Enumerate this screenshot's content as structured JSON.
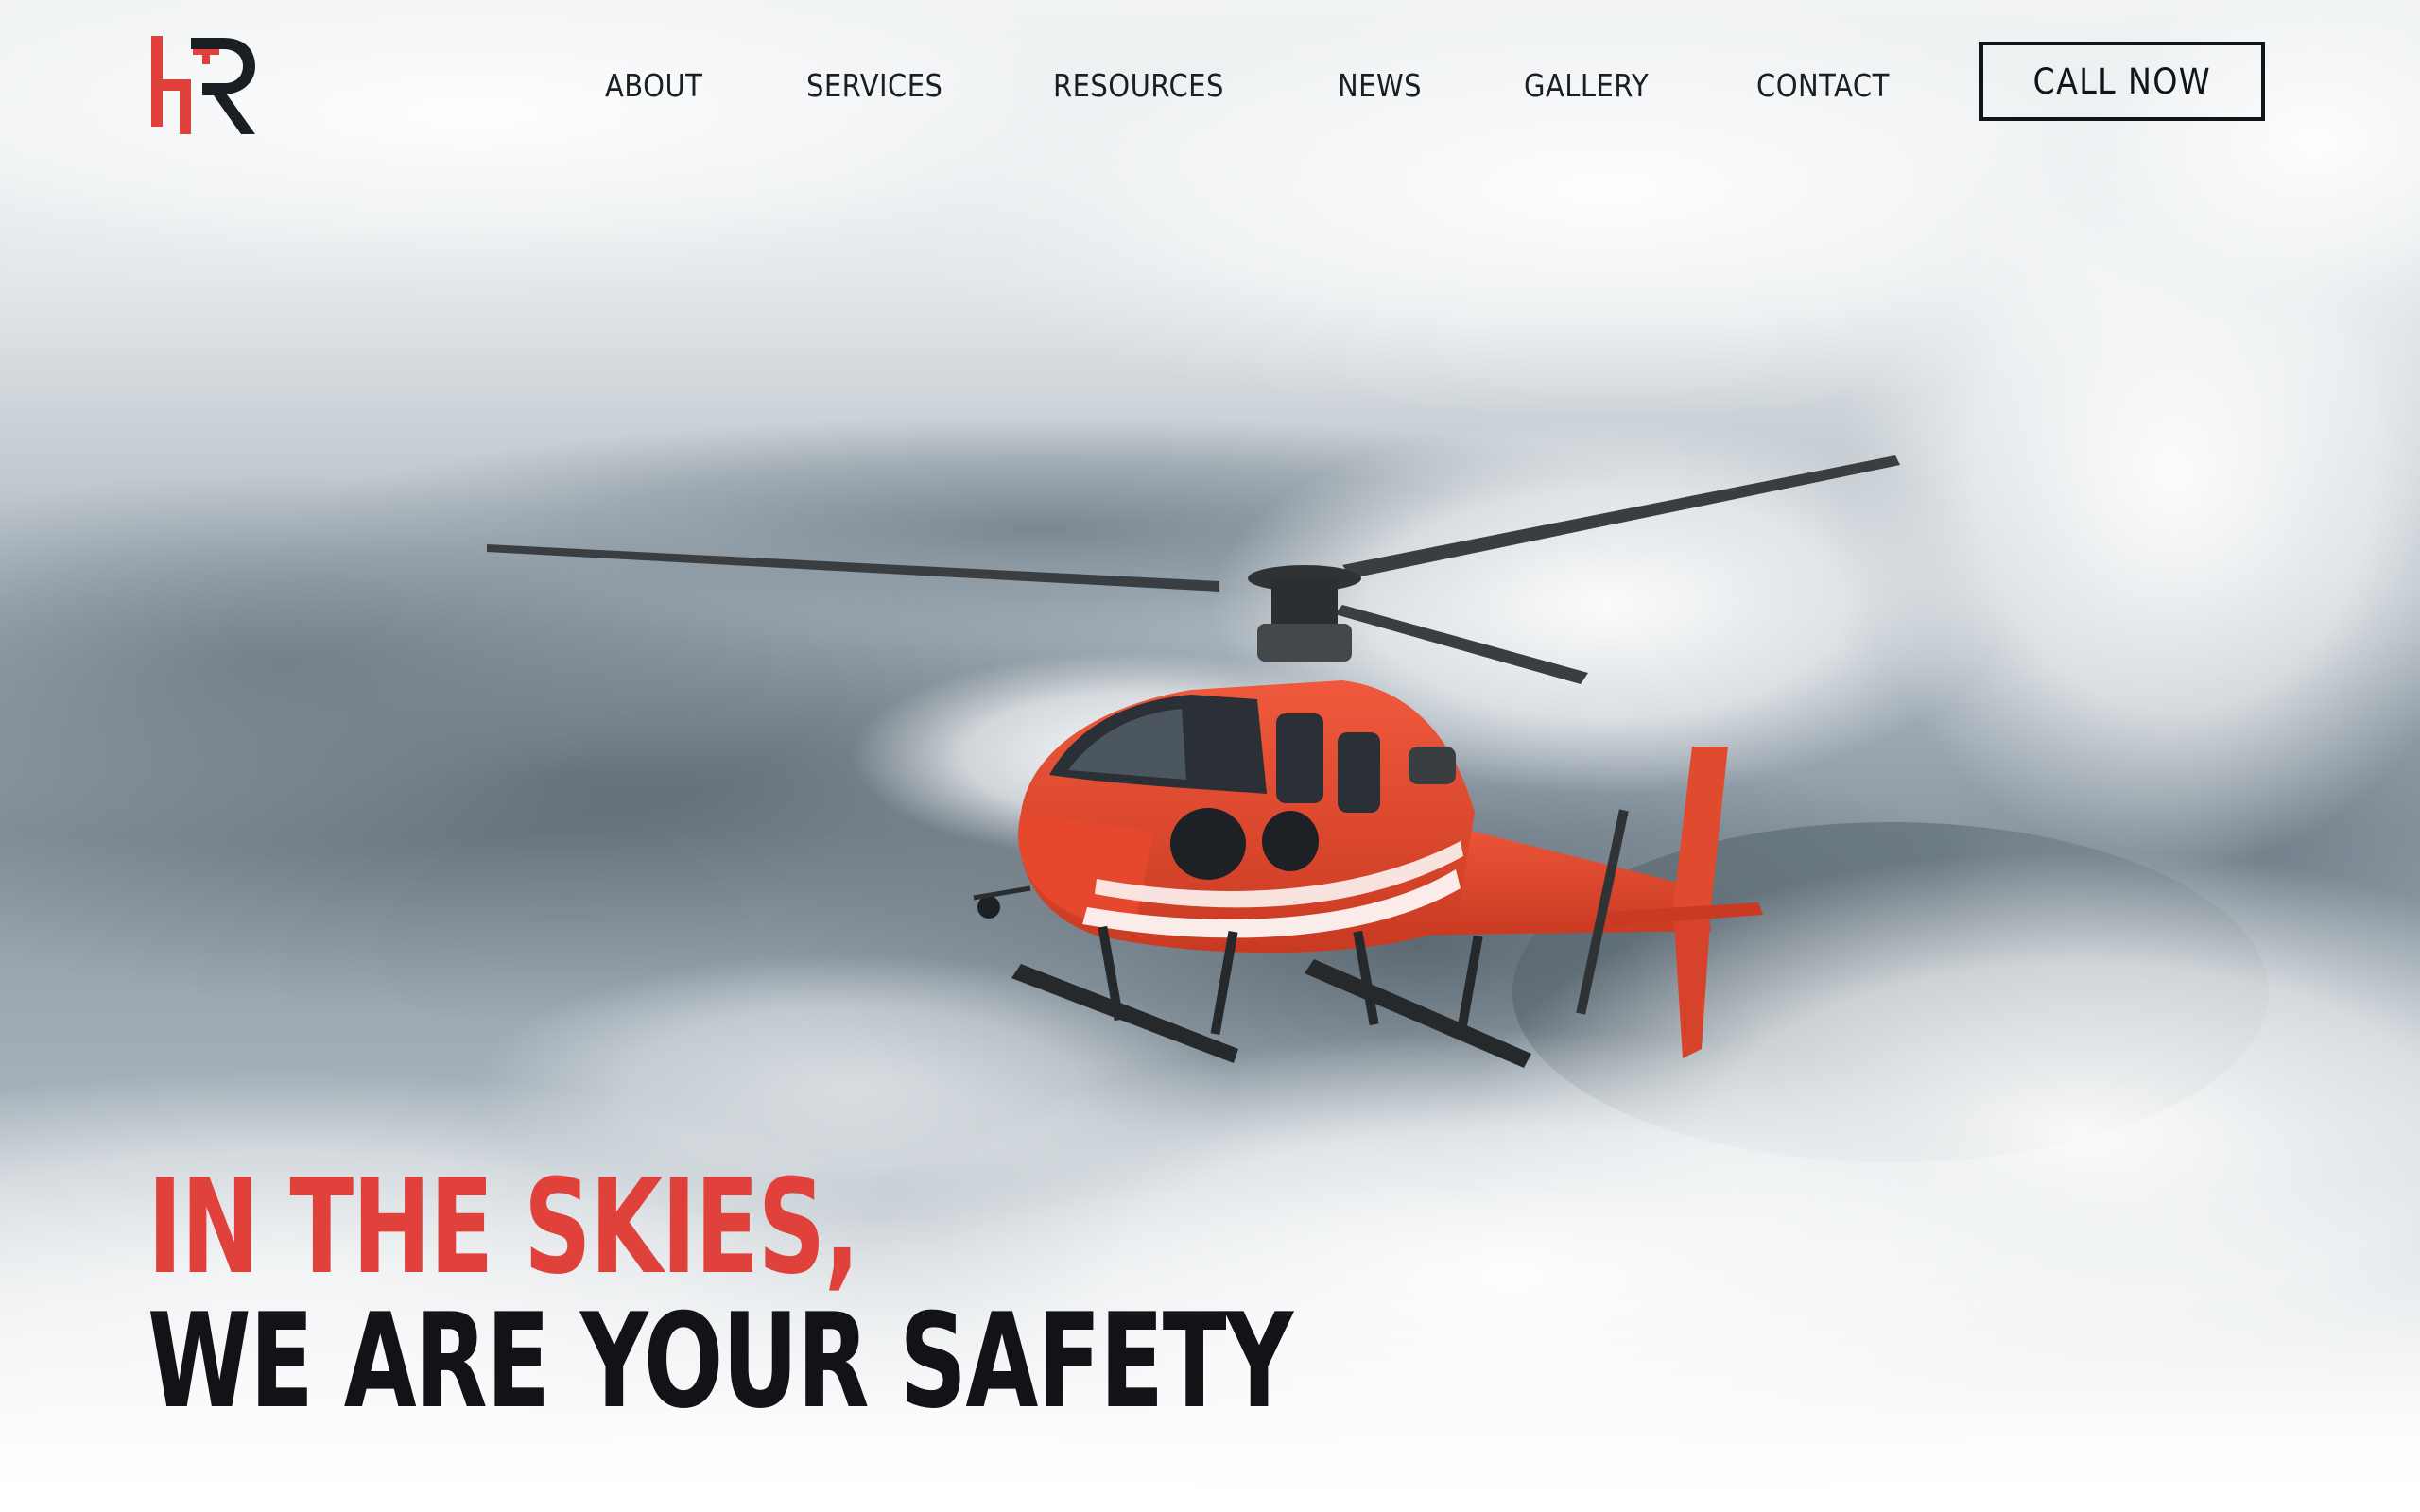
{
  "brand": {
    "logo_text": "HR",
    "accent_color": "#e0413a",
    "dark_color": "#111418"
  },
  "nav": {
    "items": [
      {
        "label": "ABOUT"
      },
      {
        "label": "SERVICES"
      },
      {
        "label": "RESOURCES"
      },
      {
        "label": "NEWS"
      },
      {
        "label": "GALLERY"
      },
      {
        "label": "CONTACT"
      }
    ]
  },
  "cta": {
    "label": "CALL NOW"
  },
  "hero": {
    "headline_line_1": "IN THE SKIES,",
    "headline_line_2": "WE ARE YOUR SAFETY",
    "image_icon": "helicopter-in-clouds"
  }
}
